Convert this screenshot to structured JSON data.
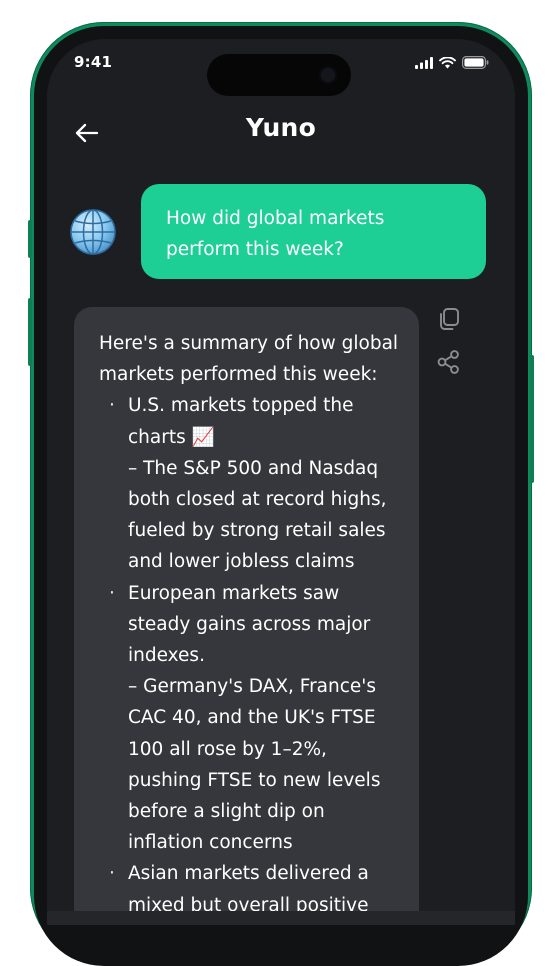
{
  "status_bar": {
    "time": "9:41",
    "icons": [
      "cellular-signal-icon",
      "wifi-icon",
      "battery-icon"
    ]
  },
  "header": {
    "title": "Yuno",
    "back_icon": "arrow-left-icon"
  },
  "colors": {
    "frame": "#0f8a5c",
    "screen_bg": "#1d1e21",
    "user_bubble": "#1dcf94",
    "assistant_bubble": "#35373c",
    "text": "#ffffff"
  },
  "conversation": {
    "user_message": "How did global markets perform this week?",
    "user_avatar_icon": "globe-icon",
    "assistant": {
      "intro": "Here's a summary of how global markets performed this week:",
      "items": [
        {
          "headline": "U.S. markets topped the charts 📈",
          "detail": "– The S&P 500 and Nasdaq both closed at record highs, fueled by strong retail sales and lower jobless claims"
        },
        {
          "headline": "European markets saw steady gains across major indexes.",
          "detail": "– Germany's DAX, France's CAC 40, and the UK's FTSE 100 all rose by 1–2%, pushing FTSE to new levels before a slight dip on inflation concerns"
        },
        {
          "headline": "Asian markets delivered a mixed but overall positive performance.",
          "detail": ""
        }
      ]
    },
    "actions": [
      "copy-icon",
      "share-icon"
    ]
  }
}
